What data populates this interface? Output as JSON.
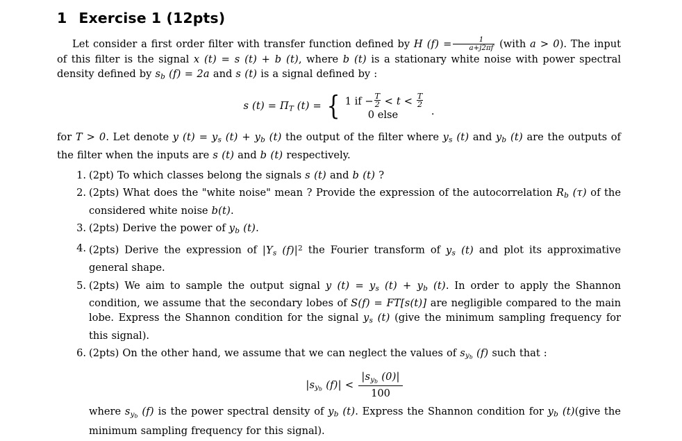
{
  "document": {
    "section_number": "1",
    "section_title": "Exercise 1 (12pts)",
    "intro": {
      "p1_a": "Let consider a first order filter with transfer function defined by",
      "p1_H_lhs": "H (f) =",
      "p1_frac_num": "1",
      "p1_frac_den": "a+j2πf",
      "p1_b": "(with",
      "p1_cond": "a > 0",
      "p1_c": "). The input of this filter is the signal",
      "p1_x": "x (t) = s (t) + b (t)",
      "p1_d": ", where",
      "p1_bt": "b (t)",
      "p1_e": "is a stationary white noise with power spectral density defined by",
      "p1_sb": "s",
      "p1_sb_sub": "b",
      "p1_sb_rest": "(f) = 2a",
      "p1_f": "and",
      "p1_st": "s (t)",
      "p1_g": "is a signal defined by :"
    },
    "equation_s": {
      "lhs": "s (t) = Π",
      "lhs_sub": "T",
      "lhs_rest": "(t) =",
      "case1_prefix": "1 if",
      "case1_minus": "−",
      "case1_frac_num": "T",
      "case1_frac_den": "2",
      "case1_mid": "< t <",
      "case1_frac2_num": "T",
      "case1_frac2_den": "2",
      "case2": "0 else",
      "trailing": "."
    },
    "intro2": {
      "a": "for",
      "T": "T > 0",
      "b": ". Let denote",
      "y": "y (t) = y",
      "y_sub1": "s",
      "y_mid": "(t) + y",
      "y_sub2": "b",
      "y_end": "(t)",
      "c": "the output of the filter where",
      "ys": "y",
      "ys_sub": "s",
      "ys_rest": "(t)",
      "d": "and",
      "yb": "y",
      "yb_sub": "b",
      "yb_rest": "(t)",
      "e": "are the outputs of the filter when the inputs are",
      "st": "s (t)",
      "f": "and",
      "bt": "b (t)",
      "g": "respectively."
    },
    "questions": [
      {
        "marker": "1.",
        "points": "(2pt)",
        "text_a": "To which classes belong the signals",
        "math_1": "s (t)",
        "text_b": "and",
        "math_2": "b (t)",
        "text_c": "?"
      },
      {
        "marker": "2.",
        "points": "(2pts)",
        "text_a": "What does the \"white noise\" mean ? Provide the expression of the autocorrelation",
        "math_1": "R",
        "math_1_sub": "b",
        "math_1_rest": "(τ)",
        "text_b": "of the considered white noise",
        "math_2": "b(t)",
        "text_c": "."
      },
      {
        "marker": "3.",
        "points": "(2pts)",
        "text_a": "Derive the power of",
        "math_1": "y",
        "math_1_sub": "b",
        "math_1_rest": "(t)",
        "text_b": "."
      },
      {
        "marker": "4.",
        "points": "(2pts)",
        "text_a": "Derive the expression of",
        "math_1": "|Y",
        "math_1_sub": "s",
        "math_1_rest": "(f)|",
        "math_1_sup": "2",
        "text_b": "the Fourier transform of",
        "math_2": "y",
        "math_2_sub": "s",
        "math_2_rest": "(t)",
        "text_c": "and plot its approximative general shape."
      },
      {
        "marker": "5.",
        "points": "(2pts)",
        "text_a": "We aim to sample the output signal",
        "math_1": "y (t) = y",
        "math_1_sub": "s",
        "math_1_mid": "(t) + y",
        "math_1_sub2": "b",
        "math_1_rest": "(t)",
        "text_b": ". In order to apply the Shannon condition, we assume that the secondary lobes of",
        "math_2": "S(f) = FT[s(t)]",
        "text_c": "are negligible compared to the main lobe. Express the Shannon condition for the signal",
        "math_3": "y",
        "math_3_sub": "s",
        "math_3_rest": "(t)",
        "text_d": "(give the minimum sampling frequency for this signal)."
      },
      {
        "marker": "6.",
        "points": "(2pts)",
        "text_a": "On the other hand, we assume that we can neglect the values of",
        "math_1": "s",
        "math_1_sub": "y",
        "math_1_subsub": "b",
        "math_1_rest": "(f)",
        "text_b": "such that :",
        "equation": {
          "lhs_s": "|s",
          "lhs_sub": "y",
          "lhs_subsub": "b",
          "lhs_rest": "(f)| <",
          "num_s": "|s",
          "num_sub": "y",
          "num_subsub": "b",
          "num_rest": "(0)|",
          "den": "100"
        },
        "text_c": "where",
        "math_2": "s",
        "math_2_sub": "y",
        "math_2_subsub": "b",
        "math_2_rest": "(f)",
        "text_d": "is the power spectral density of",
        "math_3": "y",
        "math_3_sub": "b",
        "math_3_rest": "(t)",
        "text_e": ". Express the Shannon condition for",
        "math_4": "y",
        "math_4_sub": "b",
        "math_4_rest": "(t)",
        "text_f": "(give the minimum sampling frequency for this signal)."
      }
    ]
  }
}
